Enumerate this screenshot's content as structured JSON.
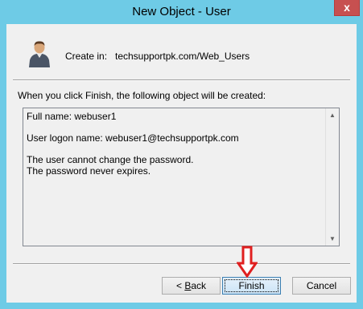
{
  "window": {
    "title": "New Object - User",
    "close_label": "x"
  },
  "header": {
    "create_in_label": "Create in:",
    "create_in_value": "techsupportpk.com/Web_Users"
  },
  "info_text": "When you click Finish, the following object will be created:",
  "summary": {
    "text": "Full name: webuser1\n\nUser logon name: webuser1@techsupportpk.com\n\nThe user cannot change the password.\nThe password never expires."
  },
  "buttons": {
    "back_prefix": "< ",
    "back_accel": "B",
    "back_rest": "ack",
    "finish": "Finish",
    "cancel": "Cancel"
  },
  "colors": {
    "title_bar": "#6ecbe6",
    "close_button": "#c75050",
    "annotation_arrow": "#e02020"
  },
  "icons": {
    "user": "user-icon",
    "arrow": "red-down-arrow-annotation"
  }
}
